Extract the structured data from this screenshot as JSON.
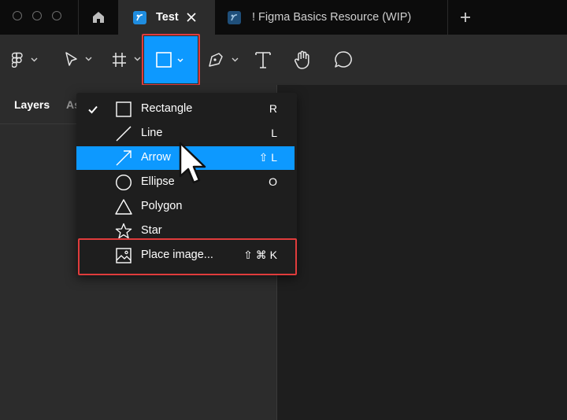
{
  "tabs": [
    {
      "label": "Test",
      "active": true
    },
    {
      "label": "! Figma Basics Resource (WIP)",
      "active": false
    }
  ],
  "toolbar": {
    "tools": [
      "main-menu",
      "move",
      "frame",
      "shape",
      "pen",
      "text",
      "hand",
      "comment"
    ],
    "active_tool": "shape",
    "accent": "#0d99ff",
    "highlight_color": "#e03c3c"
  },
  "panel": {
    "tab_layers": "Layers",
    "tab_assets": "As"
  },
  "menu": {
    "items": [
      {
        "label": "Rectangle",
        "shortcut": "R",
        "icon": "rectangle-icon",
        "checked": true
      },
      {
        "label": "Line",
        "shortcut": "L",
        "icon": "line-icon"
      },
      {
        "label": "Arrow",
        "shortcut": "⇧ L",
        "icon": "arrow-icon",
        "highlighted": true
      },
      {
        "label": "Ellipse",
        "shortcut": "O",
        "icon": "ellipse-icon"
      },
      {
        "label": "Polygon",
        "shortcut": "",
        "icon": "polygon-icon"
      },
      {
        "label": "Star",
        "shortcut": "",
        "icon": "star-icon"
      },
      {
        "label": "Place image...",
        "shortcut": "⇧ ⌘ K",
        "icon": "image-icon"
      }
    ]
  }
}
